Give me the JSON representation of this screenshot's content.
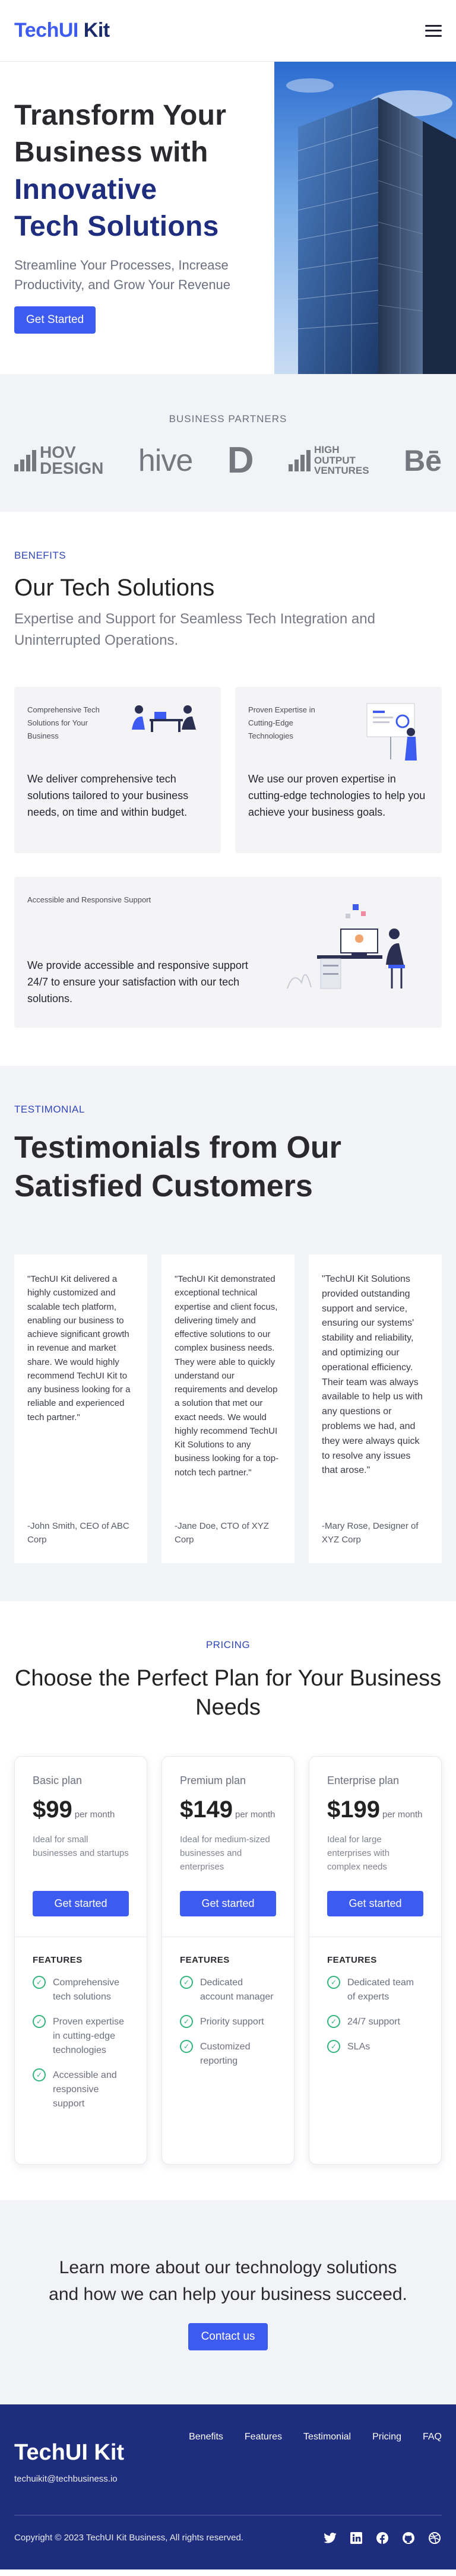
{
  "header": {
    "logo_part1": "TechUI",
    "logo_part2": "Kit",
    "menu_icon": "hamburger-menu-icon"
  },
  "hero": {
    "title_line1": "Transform Your",
    "title_line2": "Business with",
    "title_highlight1": "Innovative",
    "title_highlight2": "Tech Solutions",
    "subtitle": "Streamline Your Processes, Increase Productivity, and Grow Your Revenue",
    "cta_label": "Get Started"
  },
  "partners": {
    "title": "BUSINESS PARTNERS",
    "logos": [
      {
        "name": "hov-design-logo",
        "line1": "HOV",
        "line2": "DESIGN"
      },
      {
        "name": "hive-logo",
        "text": "hive"
      },
      {
        "name": "d-logo",
        "text": "D"
      },
      {
        "name": "high-output-ventures-logo",
        "line1": "HIGH",
        "line2": "OUTPUT",
        "line3": "VENTURES"
      },
      {
        "name": "behance-logo",
        "text": "Bē"
      }
    ]
  },
  "benefits": {
    "label": "BENEFITS",
    "title": "Our Tech Solutions",
    "subtitle": "Expertise and Support for Seamless Tech Integration and Uninterrupted Operations.",
    "cards": [
      {
        "small": "Comprehensive Tech Solutions for Your Business",
        "text": "We deliver comprehensive tech solutions tailored to your business needs, on time and within budget."
      },
      {
        "small": "Proven Expertise in Cutting-Edge Technologies",
        "text": "We use our proven expertise in cutting-edge technologies to help you achieve your business goals."
      },
      {
        "small": "Accessible and Responsive Support",
        "text": "We provide accessible and responsive support 24/7 to ensure your satisfaction with our tech solutions."
      }
    ]
  },
  "testimonials": {
    "label": "TESTIMONIAL",
    "title": "Testimonials from Our Satisfied Customers",
    "items": [
      {
        "quote": "\"TechUI Kit delivered a highly customized and scalable tech platform, enabling our business to achieve significant growth in revenue and market share. We would highly recommend TechUI Kit to any business looking for a reliable and experienced tech partner.\"",
        "author": "-John Smith, CEO of ABC Corp"
      },
      {
        "quote": "\"TechUI Kit demonstrated exceptional technical expertise and client focus, delivering timely and effective solutions to our complex business needs. They were able to quickly understand our requirements and develop a solution that met our exact needs. We would highly recommend TechUI Kit Solutions to any business looking for a top-notch tech partner.\"",
        "author": "-Jane Doe, CTO of XYZ Corp"
      },
      {
        "quote": "\"TechUI Kit Solutions provided outstanding support and service, ensuring our systems' stability and reliability, and optimizing our operational efficiency. Their team was always available to help us with any questions or problems we had, and they were always quick to resolve any issues that arose.\"",
        "author": "-Mary Rose, Designer of XYZ Corp"
      }
    ]
  },
  "pricing": {
    "label": "PRICING",
    "title": "Choose the Perfect Plan for Your Business Needs",
    "features_label": "FEATURES",
    "plans": [
      {
        "name": "Basic plan",
        "price": "$99",
        "per": "per month",
        "desc": "Ideal for small businesses and startups",
        "button": "Get started",
        "features": [
          "Comprehensive tech solutions",
          "Proven expertise in cutting-edge technologies",
          "Accessible and responsive support"
        ]
      },
      {
        "name": "Premium plan",
        "price": "$149",
        "per": "per month",
        "desc": "Ideal for medium-sized businesses and enterprises",
        "button": "Get started",
        "features": [
          "Dedicated account manager",
          "Priority support",
          "Customized reporting"
        ]
      },
      {
        "name": "Enterprise plan",
        "price": "$199",
        "per": "per month",
        "desc": "Ideal for large enterprises with complex needs",
        "button": "Get started",
        "features": [
          "Dedicated team of experts",
          "24/7 support",
          "SLAs"
        ]
      }
    ]
  },
  "cta": {
    "text": "Learn more about our technology solutions and how we can help your business succeed.",
    "button": "Contact us"
  },
  "footer": {
    "logo": "TechUI Kit",
    "email": "techuikit@techbusiness.io",
    "nav": [
      "Benefits",
      "Features",
      "Testimonial",
      "Pricing",
      "FAQ"
    ],
    "copyright": "Copyright © 2023 TechUI Kit Business, All rights reserved.",
    "socials": [
      "twitter-icon",
      "linkedin-icon",
      "facebook-icon",
      "github-icon",
      "dribbble-icon"
    ]
  },
  "colors": {
    "primary": "#3d5bf0",
    "navy": "#1e2d7d",
    "success": "#31b57a",
    "light_bg": "#f2f3f6"
  }
}
